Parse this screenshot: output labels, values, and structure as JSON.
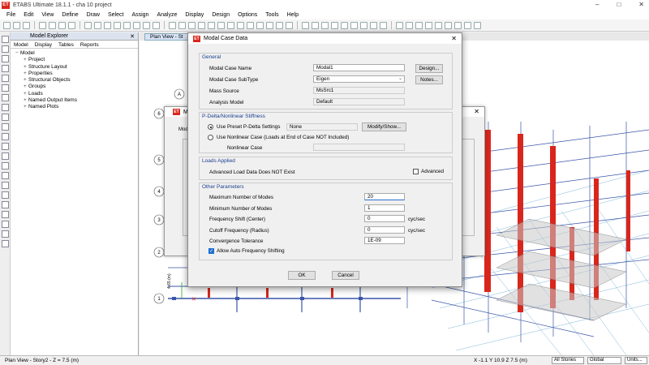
{
  "app": {
    "logo": "ET",
    "title": "ETABS Ultimate 18.1.1 - cha 10 project",
    "window_controls": [
      "–",
      "□",
      "✕"
    ]
  },
  "menu": [
    "File",
    "Edit",
    "View",
    "Define",
    "Draw",
    "Select",
    "Assign",
    "Analyze",
    "Display",
    "Design",
    "Options",
    "Tools",
    "Help"
  ],
  "explorer": {
    "title": "Model Explorer",
    "close": "✕",
    "tabs": [
      "Model",
      "Display",
      "Tables",
      "Reports"
    ],
    "root": "Model",
    "items": [
      "Project",
      "Structure Layout",
      "Properties",
      "Structural Objects",
      "Groups",
      "Loads",
      "Named Output Items",
      "Named Plots"
    ]
  },
  "view_tab": "Plan View - St",
  "bg_dialog": {
    "logo": "ET",
    "title": "Mod",
    "close": "✕",
    "label": "Mod"
  },
  "plan_labels": {
    "grid_a": "A",
    "rows": [
      "6",
      "5",
      "4",
      "3",
      "2",
      "1"
    ],
    "dimension": "4.65 (m)"
  },
  "dialog": {
    "logo": "ET",
    "title": "Modal Case Data",
    "close": "✕",
    "general": {
      "title": "General",
      "case_name_label": "Modal Case Name",
      "case_name_value": "Modal1",
      "design_button": "Design...",
      "subtype_label": "Modal Case SubType",
      "subtype_value": "Eigen",
      "notes_button": "Notes...",
      "mass_label": "Mass Source",
      "mass_value": "MsSrc1",
      "model_label": "Analysis Model",
      "model_value": "Default"
    },
    "pdelta": {
      "title": "P-Delta/Nonlinear Stiffness",
      "preset_label": "Use Preset P-Delta Settings",
      "preset_value": "None",
      "modify_button": "Modify/Show...",
      "nonlinear_label": "Use Nonlinear Case  (Loads at End of Case NOT Included)",
      "nonlinear_case_label": "Nonlinear Case"
    },
    "loads": {
      "title": "Loads Applied",
      "text": "Advanced Load Data Does NOT Exist",
      "advanced_label": "Advanced"
    },
    "other": {
      "title": "Other Parameters",
      "max_modes_label": "Maximum Number of Modes",
      "max_modes_value": "20",
      "min_modes_label": "Minimum Number of Modes",
      "min_modes_value": "1",
      "shift_label": "Frequency Shift  (Center)",
      "shift_value": "0",
      "shift_unit": "cyc/sec",
      "cutoff_label": "Cutoff Frequency  (Radius)",
      "cutoff_value": "0",
      "cutoff_unit": "cyc/sec",
      "tol_label": "Convergence Tolerance",
      "tol_value": "1E-09",
      "auto_shift_label": "Allow Auto Frequency Shifting"
    },
    "ok_button": "OK",
    "cancel_button": "Cancel"
  },
  "status": {
    "left": "Plan View - Story2 - Z = 7.5 (m)",
    "coords": "X -1.1  Y 10.9  Z 7.5 (m)",
    "stories": "All Stories",
    "global": "Global",
    "units": "Units..."
  },
  "colors": {
    "accent": "#1f6fd1",
    "column_red": "#d9261c",
    "frame_blue": "#3a55a8"
  }
}
